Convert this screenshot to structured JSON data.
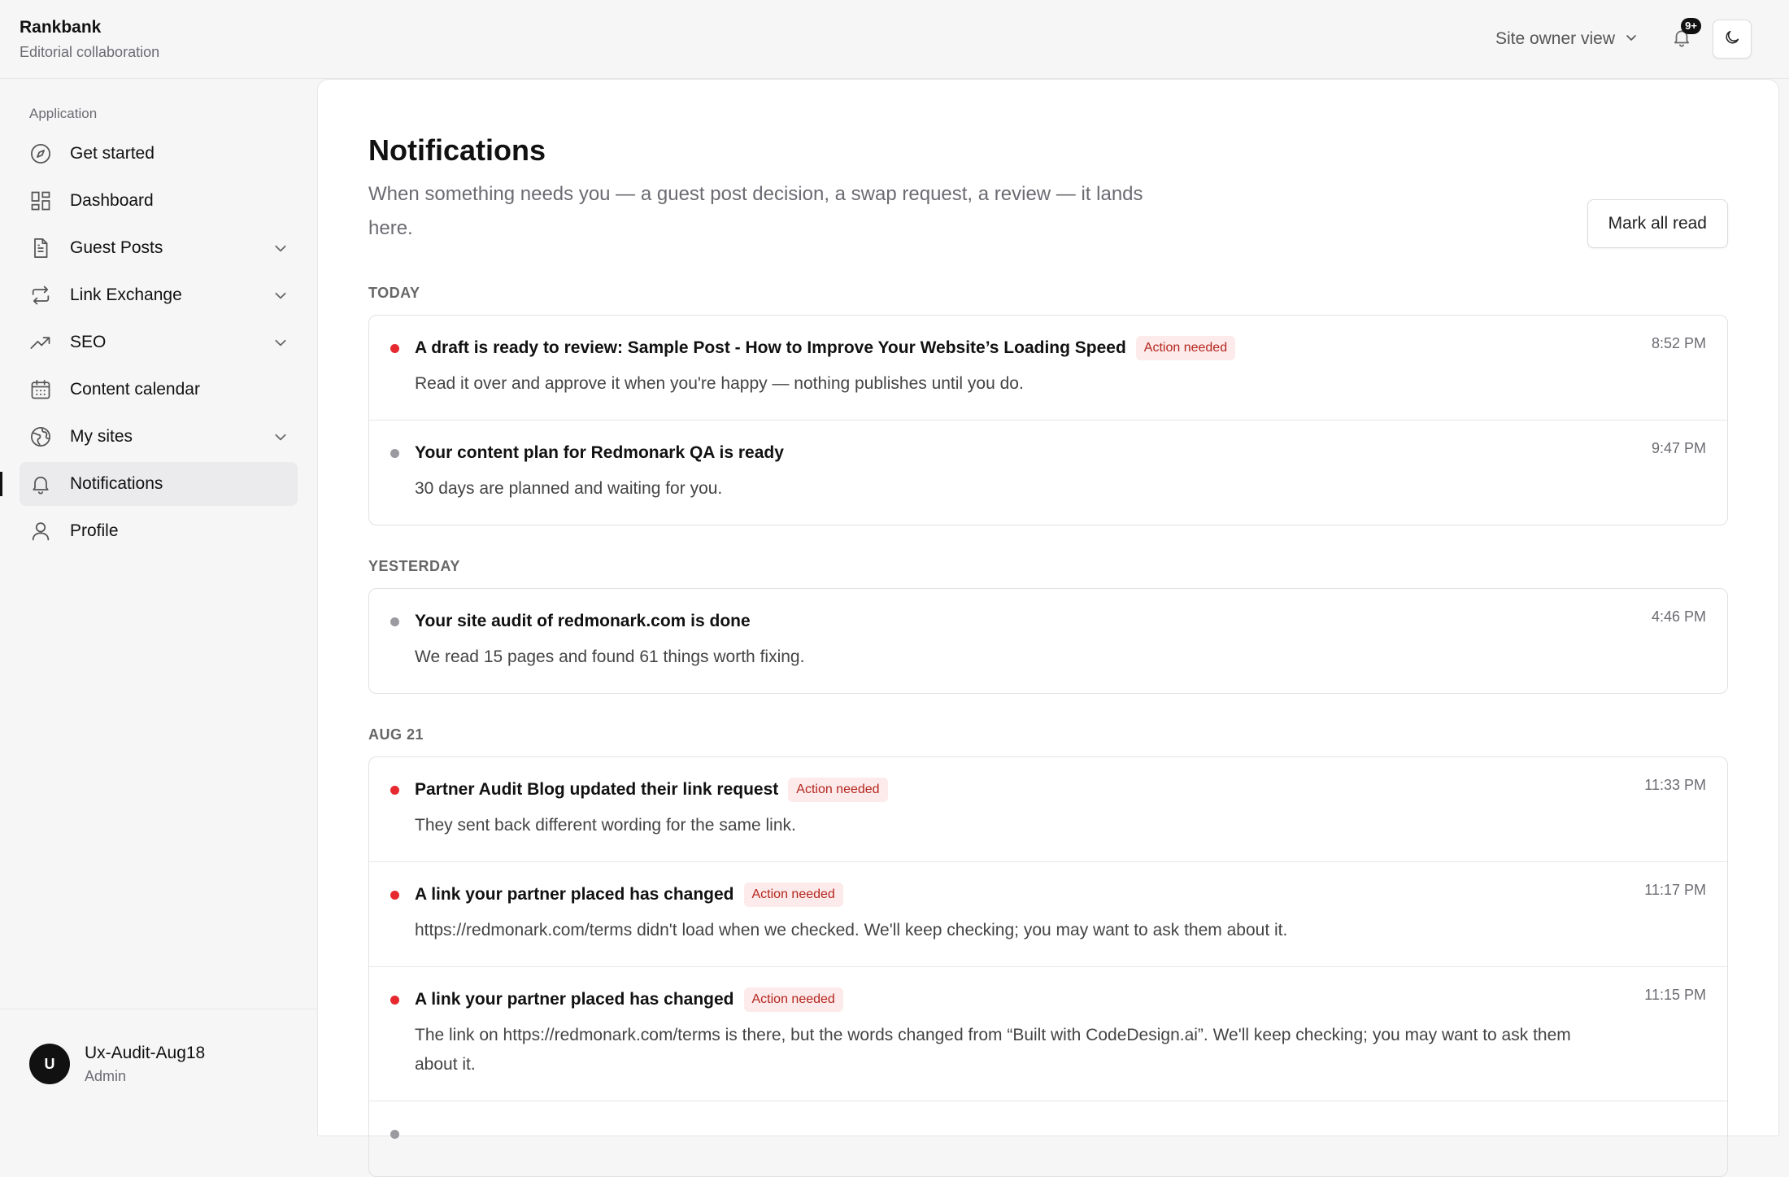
{
  "app": {
    "name": "Rankbank",
    "subtitle": "Editorial collaboration"
  },
  "header": {
    "view_label": "Site owner view",
    "badge": "9+"
  },
  "sidebar": {
    "section": "Application",
    "items": [
      {
        "label": "Get started"
      },
      {
        "label": "Dashboard"
      },
      {
        "label": "Guest Posts"
      },
      {
        "label": "Link Exchange"
      },
      {
        "label": "SEO"
      },
      {
        "label": "Content calendar"
      },
      {
        "label": "My sites"
      },
      {
        "label": "Notifications"
      },
      {
        "label": "Profile"
      }
    ],
    "user": {
      "initial": "U",
      "name": "Ux-Audit-Aug18",
      "role": "Admin"
    }
  },
  "page": {
    "title": "Notifications",
    "description": "When something needs you — a guest post decision, a swap request, a review — it lands here.",
    "mark_all": "Mark all read"
  },
  "colors": {
    "unread": "#e5292f",
    "read": "#9a9aa0"
  },
  "groups": [
    {
      "label": "TODAY",
      "items": [
        {
          "title": "A draft is ready to review: Sample Post - How to Improve Your Website’s Loading Speed",
          "badge": "Action needed",
          "body": "Read it over and approve it when you're happy — nothing publishes until you do.",
          "time": "8:52 PM"
        },
        {
          "title": "Your content plan for Redmonark QA is ready",
          "badge": "",
          "body": "30 days are planned and waiting for you.",
          "time": "9:47 PM"
        }
      ]
    },
    {
      "label": "YESTERDAY",
      "items": [
        {
          "title": "Your site audit of redmonark.com is done",
          "badge": "",
          "body": "We read 15 pages and found 61 things worth fixing.",
          "time": "4:46 PM"
        }
      ]
    },
    {
      "label": "AUG 21",
      "items": [
        {
          "title": "Partner Audit Blog updated their link request",
          "badge": "Action needed",
          "body": "They sent back different wording for the same link.",
          "time": "11:33 PM"
        },
        {
          "title": "A link your partner placed has changed",
          "badge": "Action needed",
          "body": "https://redmonark.com/terms didn't load when we checked. We'll keep checking; you may want to ask them about it.",
          "time": "11:17 PM"
        },
        {
          "title": "A link your partner placed has changed",
          "badge": "Action needed",
          "body": "The link on https://redmonark.com/terms is there, but the words changed from “Built with CodeDesign.ai”. We'll keep checking; you may want to ask them about it.",
          "time": "11:15 PM"
        },
        {
          "title": "",
          "badge": "",
          "body": "",
          "time": ""
        }
      ]
    }
  ]
}
